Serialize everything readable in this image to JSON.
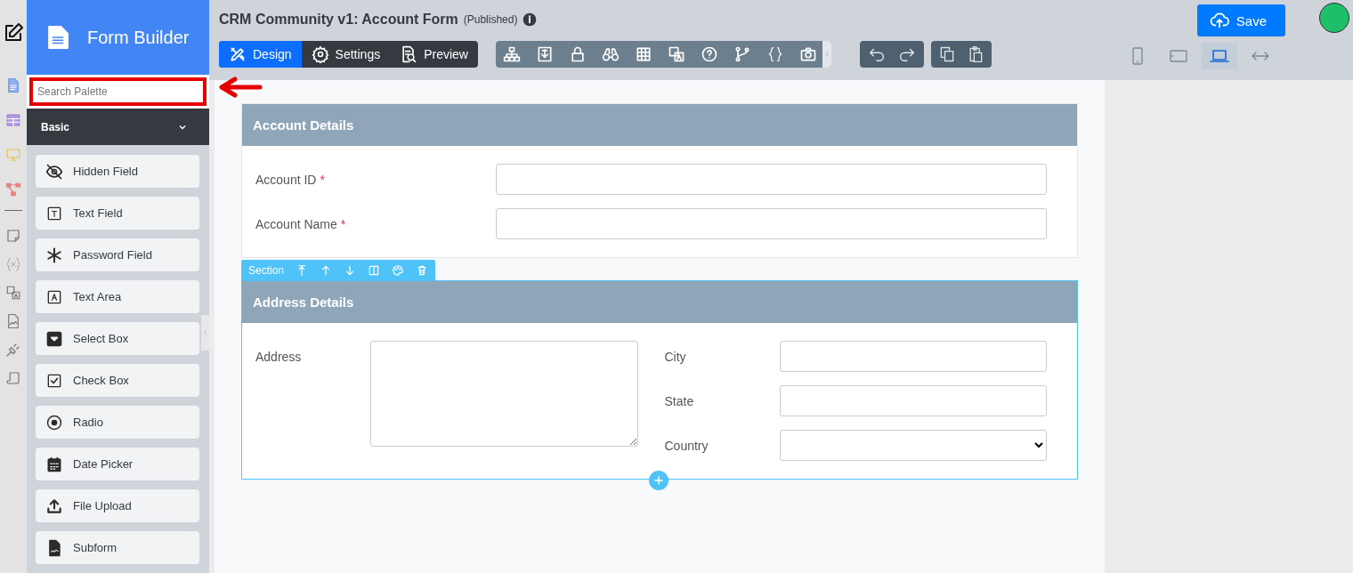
{
  "sidebar": {
    "title": "Form Builder",
    "search": {
      "placeholder": "Search Palette",
      "highlighted": true
    },
    "group": {
      "label": "Basic",
      "expanded": true
    },
    "items": [
      {
        "label": "Hidden Field",
        "kind": "hidden"
      },
      {
        "label": "Text Field",
        "kind": "text"
      },
      {
        "label": "Password Field",
        "kind": "password"
      },
      {
        "label": "Text Area",
        "kind": "textarea"
      },
      {
        "label": "Select Box",
        "kind": "select"
      },
      {
        "label": "Check Box",
        "kind": "checkbox"
      },
      {
        "label": "Radio",
        "kind": "radio"
      },
      {
        "label": "Date Picker",
        "kind": "date"
      },
      {
        "label": "File Upload",
        "kind": "upload"
      },
      {
        "label": "Subform",
        "kind": "subform"
      }
    ]
  },
  "topbar": {
    "title": "CRM Community v1: Account Form",
    "status": "(Published)",
    "save": "Save",
    "tabs": [
      {
        "label": "Design",
        "kind": "design",
        "selected": true
      },
      {
        "label": "Settings",
        "kind": "settings",
        "selected": false
      },
      {
        "label": "Preview",
        "kind": "preview",
        "selected": false
      }
    ],
    "devices": [
      {
        "kind": "phone",
        "selected": false
      },
      {
        "kind": "tablet",
        "selected": false
      },
      {
        "kind": "laptop",
        "selected": true
      },
      {
        "kind": "full",
        "selected": false
      }
    ]
  },
  "form": {
    "sections": [
      {
        "title": "Account Details",
        "selected": false,
        "columns": [
          [
            {
              "label": "Account ID",
              "kind": "text",
              "required_mark": "*"
            },
            {
              "label": "Account Name",
              "kind": "text",
              "required_mark": "*"
            }
          ]
        ]
      },
      {
        "title": "Address Details",
        "selected": true,
        "toolbar_label": "Section",
        "columns": [
          [
            {
              "label": "Address",
              "kind": "textarea"
            }
          ],
          [
            {
              "label": "City",
              "kind": "text"
            },
            {
              "label": "State",
              "kind": "text"
            },
            {
              "label": "Country",
              "kind": "select"
            }
          ]
        ]
      }
    ]
  }
}
